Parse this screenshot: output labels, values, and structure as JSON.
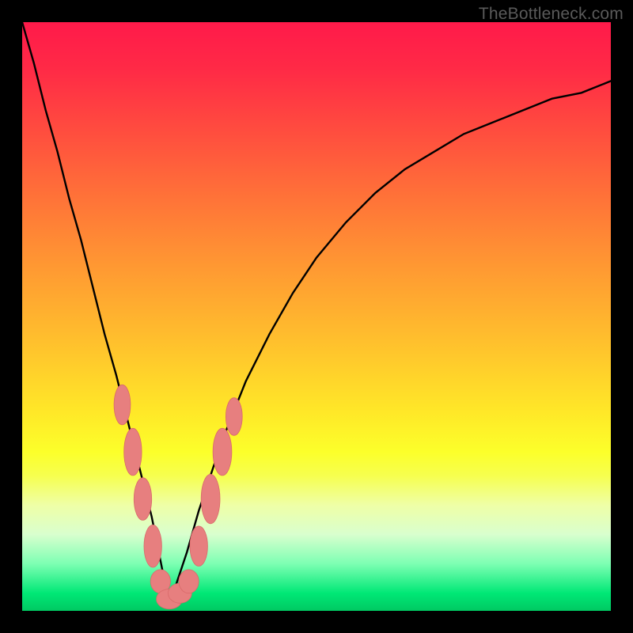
{
  "watermark": "TheBottleneck.com",
  "colors": {
    "frame": "#000000",
    "curve_stroke": "#000000",
    "marker_fill": "#e77f7f",
    "marker_stroke": "#d96a6a"
  },
  "chart_data": {
    "type": "line",
    "title": "",
    "xlabel": "",
    "ylabel": "",
    "xlim": [
      0,
      100
    ],
    "ylim": [
      0,
      100
    ],
    "note": "Axes are unlabeled; values are normalized 0–100 estimated from pixel positions. Background color encodes y (red=high, green=low). The black curve forms a V with minimum near x≈25, y≈0; pink rounded markers lie on the curve near the trough.",
    "series": [
      {
        "name": "black-curve",
        "x": [
          0,
          2,
          4,
          6,
          8,
          10,
          12,
          14,
          16,
          18,
          20,
          22,
          24,
          25,
          26,
          28,
          30,
          32,
          34,
          38,
          42,
          46,
          50,
          55,
          60,
          65,
          70,
          75,
          80,
          85,
          90,
          95,
          100
        ],
        "y": [
          100,
          93,
          85,
          78,
          70,
          63,
          55,
          47,
          40,
          32,
          24,
          16,
          6,
          2,
          4,
          10,
          17,
          23,
          29,
          39,
          47,
          54,
          60,
          66,
          71,
          75,
          78,
          81,
          83,
          85,
          87,
          88,
          90
        ]
      }
    ],
    "markers": [
      {
        "name": "left-cluster-4",
        "x": 17.0,
        "y": 35,
        "rx": 1.4,
        "ry": 3.4
      },
      {
        "name": "left-cluster-3",
        "x": 18.8,
        "y": 27,
        "rx": 1.5,
        "ry": 4.0
      },
      {
        "name": "left-cluster-2",
        "x": 20.5,
        "y": 19,
        "rx": 1.5,
        "ry": 3.6
      },
      {
        "name": "left-cluster-1",
        "x": 22.2,
        "y": 11,
        "rx": 1.5,
        "ry": 3.6
      },
      {
        "name": "trough-1",
        "x": 23.5,
        "y": 5,
        "rx": 1.7,
        "ry": 2.0
      },
      {
        "name": "trough-2",
        "x": 25.0,
        "y": 2,
        "rx": 2.2,
        "ry": 1.7
      },
      {
        "name": "trough-3",
        "x": 26.8,
        "y": 3,
        "rx": 2.0,
        "ry": 1.7
      },
      {
        "name": "trough-4",
        "x": 28.3,
        "y": 5,
        "rx": 1.7,
        "ry": 2.0
      },
      {
        "name": "right-cluster-1",
        "x": 30.0,
        "y": 11,
        "rx": 1.5,
        "ry": 3.4
      },
      {
        "name": "right-cluster-2",
        "x": 32.0,
        "y": 19,
        "rx": 1.6,
        "ry": 4.2
      },
      {
        "name": "right-cluster-3",
        "x": 34.0,
        "y": 27,
        "rx": 1.6,
        "ry": 4.0
      },
      {
        "name": "right-cluster-4",
        "x": 36.0,
        "y": 33,
        "rx": 1.4,
        "ry": 3.2
      }
    ]
  }
}
